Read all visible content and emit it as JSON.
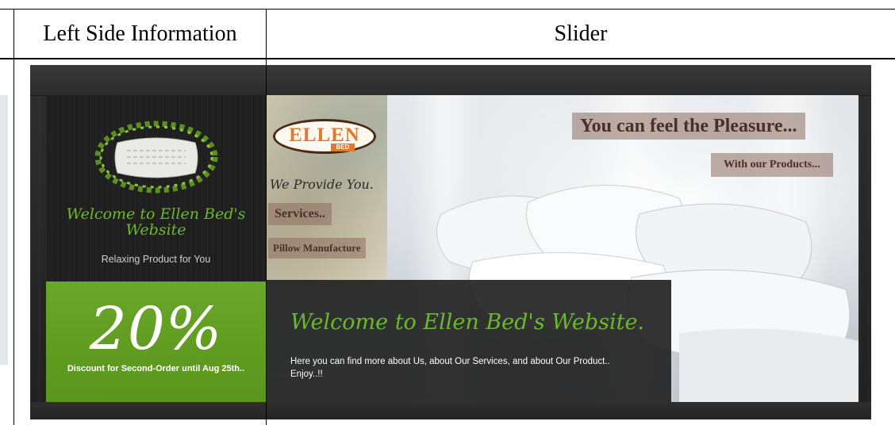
{
  "table": {
    "left_header": "Left Side Information",
    "right_header": "Slider"
  },
  "left_panel": {
    "welcome": "Welcome to Ellen Bed's Website",
    "tagline": "Relaxing Product for You"
  },
  "promo": {
    "number": "20%",
    "text": "Discount for Second-Order until Aug 25th.."
  },
  "slider": {
    "brand_name": "ELLEN",
    "brand_sub": "BED",
    "provide": "We Provide You.",
    "tag_services": "Services..",
    "tag_pillow": "Pillow Manufacture",
    "headline": "You can feel the Pleasure...",
    "subheadline": "With our Products...",
    "caption_title": "Welcome to Ellen Bed's Website.",
    "caption_text": "Here you can find more about Us, about Our Services, and about Our Product.. Enjoy..!!"
  },
  "colors": {
    "accent_green": "#6ab92a",
    "promo_green": "#5f9a20",
    "brand_orange": "#e07a2a"
  },
  "icons": [
    "pillow-wreath-logo"
  ]
}
